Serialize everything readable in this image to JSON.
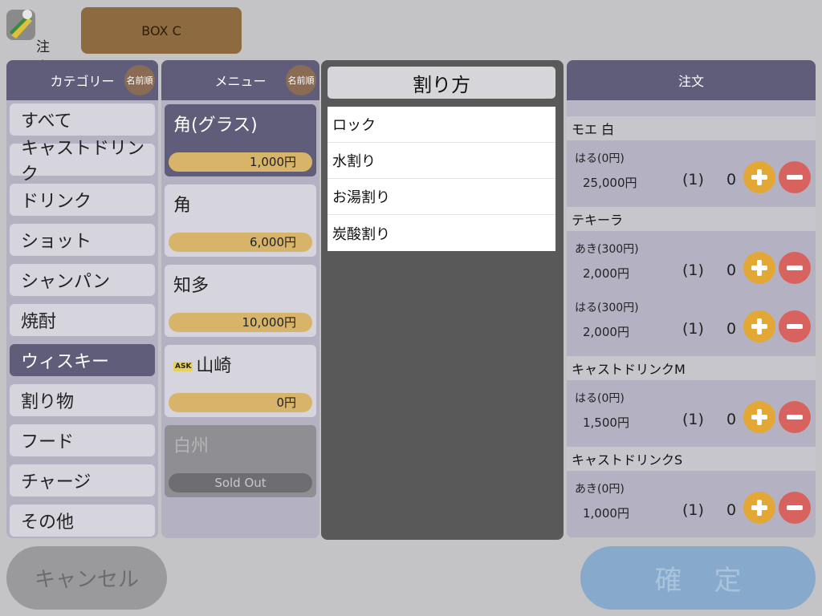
{
  "header": {
    "app_label": "注文",
    "table_button": "BOX C"
  },
  "category": {
    "title": "カテゴリー",
    "sort_label": "名前順",
    "items": [
      "すべて",
      "キャストドリンク",
      "ドリンク",
      "ショット",
      "シャンパン",
      "焼酎",
      "ウィスキー",
      "割り物",
      "フード",
      "チャージ",
      "その他"
    ],
    "selected": "ウィスキー"
  },
  "menu": {
    "title": "メニュー",
    "sort_label": "名前順",
    "items": [
      {
        "name": "角(グラス)",
        "price": "1,000円"
      },
      {
        "name": "角",
        "price": "6,000円"
      },
      {
        "name": "知多",
        "price": "10,000円"
      },
      {
        "name": "山崎",
        "badge": "ASK",
        "price": "0円"
      },
      {
        "name": "白州",
        "status": "Sold Out"
      }
    ]
  },
  "split": {
    "title": "割り方",
    "options": [
      "ロック",
      "水割り",
      "お湯割り",
      "炭酸割り"
    ]
  },
  "order": {
    "title": "注文",
    "groups": [
      {
        "name": "モエ 白",
        "rows": [
          {
            "staff": "はる(0円)",
            "amount": "25,000円",
            "qty": "(1)",
            "count": "0"
          }
        ]
      },
      {
        "name": "テキーラ",
        "rows": [
          {
            "staff": "あき(300円)",
            "amount": "2,000円",
            "qty": "(1)",
            "count": "0"
          },
          {
            "staff": "はる(300円)",
            "amount": "2,000円",
            "qty": "(1)",
            "count": "0"
          }
        ]
      },
      {
        "name": "キャストドリンクM",
        "rows": [
          {
            "staff": "はる(0円)",
            "amount": "1,500円",
            "qty": "(1)",
            "count": "0"
          }
        ]
      },
      {
        "name": "キャストドリンクS",
        "rows": [
          {
            "staff": "あき(0円)",
            "amount": "1,000円",
            "qty": "(1)",
            "count": "0"
          }
        ]
      }
    ]
  },
  "footer": {
    "cancel_label": "キャンセル",
    "confirm_label": "確定"
  },
  "colors": {
    "panel_header": "#5f5d79",
    "selected": "#5f5d79",
    "price_bar": "#d7b46a",
    "plus": "#e3a735",
    "minus": "#d8635e",
    "table_button": "#8e6a40",
    "confirm": "#87aacc"
  }
}
